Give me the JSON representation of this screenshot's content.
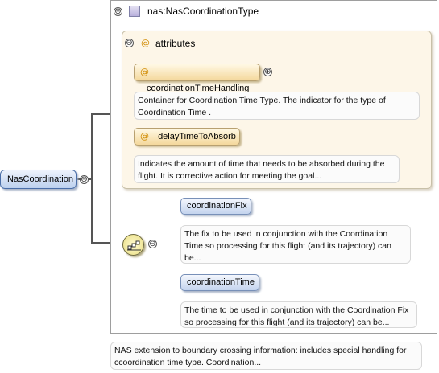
{
  "complex_type": {
    "name": "nas:NasCoordinationType",
    "icon": "complex-type-icon"
  },
  "attributes_group": {
    "title": "attributes",
    "items": [
      {
        "name": "coordinationTimeHandling",
        "doc": "Container for Coordination Time Type. The indicator for the type of Coordination Time ."
      },
      {
        "name": "delayTimeToAbsorb",
        "doc": "Indicates the amount of time that needs to be absorbed during the flight. It is corrective action for meeting the goal..."
      }
    ]
  },
  "root_element": {
    "name": "NasCoordination",
    "doc": "NAS extension to boundary crossing information: includes special handling for ccoordination time type. Coordination..."
  },
  "sequence": {
    "icon": "sequence-icon",
    "children": [
      {
        "name": "coordinationFix",
        "doc": "The fix to be used in conjunction with the Coordination Time so processing for this flight (and its trajectory) can be..."
      },
      {
        "name": "coordinationTime",
        "doc": "The time to be used in conjunction with the Coordination Fix so processing for this flight (and its trajectory) can be..."
      }
    ]
  },
  "symbols": {
    "collapse": "⊖",
    "expand": "⊕",
    "attribute_marker": "@"
  }
}
